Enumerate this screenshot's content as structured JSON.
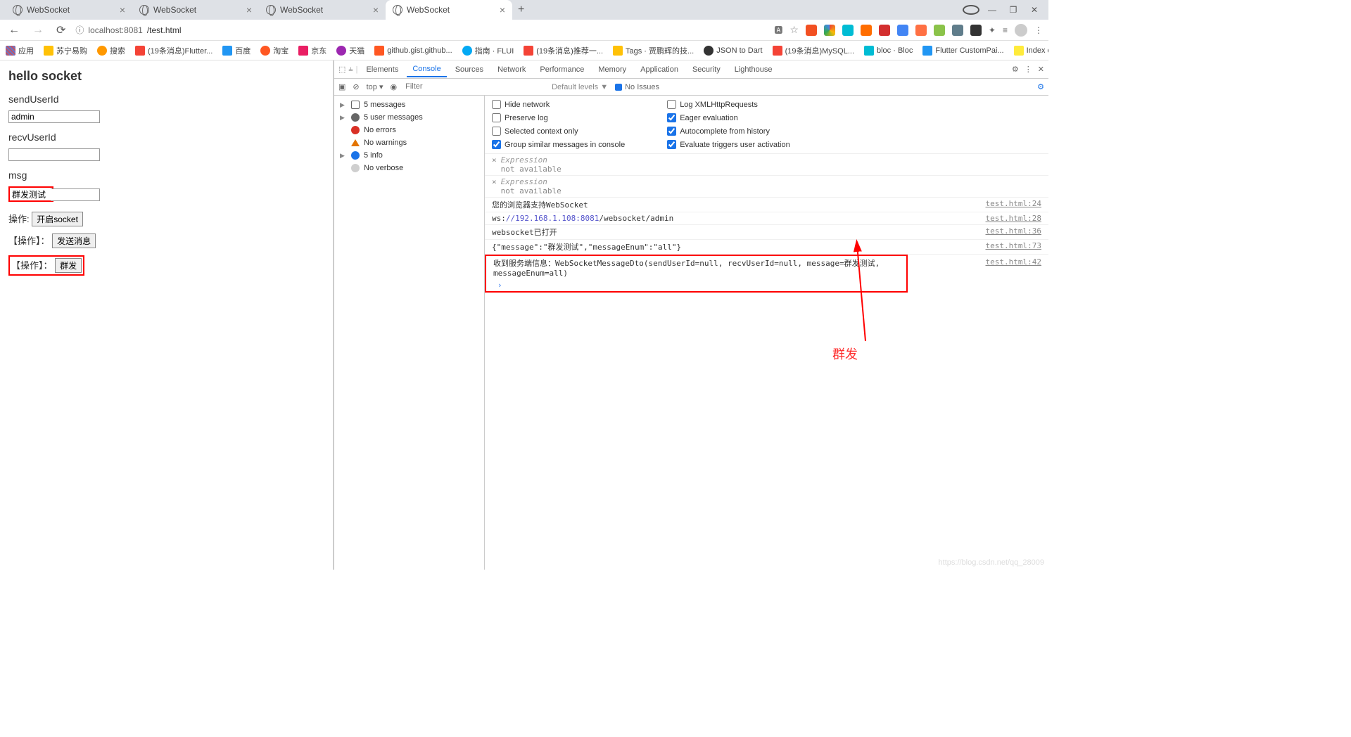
{
  "browser": {
    "tabs": [
      {
        "title": "WebSocket",
        "active": false
      },
      {
        "title": "WebSocket",
        "active": false
      },
      {
        "title": "WebSocket",
        "active": false
      },
      {
        "title": "WebSocket",
        "active": true
      }
    ],
    "url_host": "localhost:8081",
    "url_path": "/test.html",
    "info_icon": "ⓘ"
  },
  "bookmarks": [
    {
      "label": "应用"
    },
    {
      "label": "苏宁易购"
    },
    {
      "label": "搜索"
    },
    {
      "label": "(19条消息)Flutter..."
    },
    {
      "label": "百度"
    },
    {
      "label": "淘宝"
    },
    {
      "label": "京东"
    },
    {
      "label": "天猫"
    },
    {
      "label": "github.gist.github..."
    },
    {
      "label": "指南 · FLUI"
    },
    {
      "label": "(19条消息)推荐一..."
    },
    {
      "label": "Tags · 贾鹏辉的技..."
    },
    {
      "label": "JSON to Dart"
    },
    {
      "label": "(19条消息)MySQL..."
    },
    {
      "label": "bloc · Bloc"
    },
    {
      "label": "Flutter CustomPai..."
    },
    {
      "label": "Index of /flutter/fl..."
    }
  ],
  "page": {
    "heading": "hello socket",
    "send_label": "sendUserId",
    "send_value": "admin",
    "recv_label": "recvUserId",
    "recv_value": "",
    "msg_label": "msg",
    "msg_value": "群发测试",
    "op1_label": "操作:",
    "op1_btn": "开启socket",
    "op2_label": "【操作】：",
    "op2_btn": "发送消息",
    "op3_label": "【操作】：",
    "op3_btn": "群发"
  },
  "devtools": {
    "tabs": [
      "Elements",
      "Console",
      "Sources",
      "Network",
      "Performance",
      "Memory",
      "Application",
      "Security",
      "Lighthouse"
    ],
    "active_tab": "Console",
    "context": "top",
    "filter_placeholder": "Filter",
    "levels": "Default levels ▼",
    "issues": "No Issues",
    "sidebar": [
      {
        "type": "msg",
        "label": "5 messages"
      },
      {
        "type": "user",
        "label": "5 user messages"
      },
      {
        "type": "err",
        "label": "No errors"
      },
      {
        "type": "warn",
        "label": "No warnings"
      },
      {
        "type": "info",
        "label": "5 info"
      },
      {
        "type": "verb",
        "label": "No verbose"
      }
    ],
    "options_left": [
      {
        "checked": false,
        "label": "Hide network"
      },
      {
        "checked": false,
        "label": "Preserve log"
      },
      {
        "checked": false,
        "label": "Selected context only"
      },
      {
        "checked": true,
        "label": "Group similar messages in console"
      }
    ],
    "options_right": [
      {
        "checked": false,
        "label": "Log XMLHttpRequests"
      },
      {
        "checked": true,
        "label": "Eager evaluation"
      },
      {
        "checked": true,
        "label": "Autocomplete from history"
      },
      {
        "checked": true,
        "label": "Evaluate triggers user activation"
      }
    ],
    "expr_label": "Expression",
    "expr_na": "not available",
    "logs": [
      {
        "text": "您的浏览器支持WebSocket",
        "src": "test.html:24"
      },
      {
        "text_pre": "ws:",
        "text_link": "//192.168.1.108:8081",
        "text_post": "/websocket/admin",
        "src": "test.html:28"
      },
      {
        "text": "websocket已打开",
        "src": "test.html:36"
      },
      {
        "text": "{\"message\":\"群发测试\",\"messageEnum\":\"all\"}",
        "src": "test.html:73"
      }
    ],
    "highlighted_log": {
      "text": "收到服务端信息：WebSocketMessageDto(sendUserId=null, recvUserId=null, message=群发测试, messageEnum=all)",
      "src": "test.html:42"
    }
  },
  "annotation": "群发",
  "watermark": "https://blog.csdn.net/qq_28009"
}
